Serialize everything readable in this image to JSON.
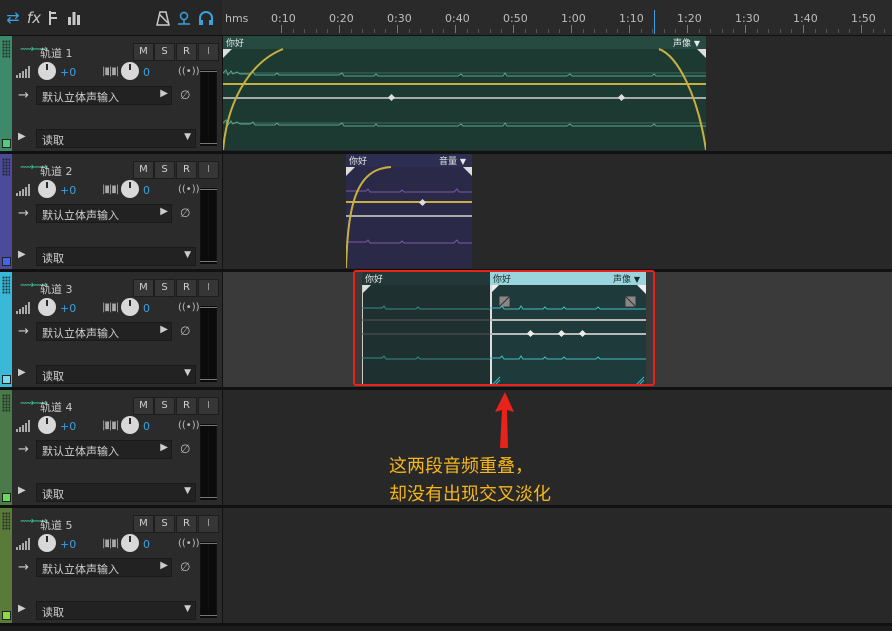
{
  "toolbar": {
    "icons": [
      "swap-icon",
      "fx-icon",
      "send-icon",
      "meter-icon",
      "metronome-icon",
      "record-monitor-icon",
      "headphones-icon"
    ],
    "fx_label": "fx"
  },
  "ruler": {
    "unit": "hms",
    "labels": [
      "0:10",
      "0:20",
      "0:30",
      "0:40",
      "0:50",
      "1:00",
      "1:10",
      "1:20",
      "1:30",
      "1:40",
      "1:50"
    ]
  },
  "tracks": [
    {
      "name": "轨道 1",
      "color": "#3d8a6a",
      "square": "#55cc77",
      "volume": "+0",
      "pan": "0",
      "input": "默认立体声输入",
      "automation": "读取",
      "btn_m": "M",
      "btn_s": "S",
      "btn_r": "R",
      "btn_i": "I"
    },
    {
      "name": "轨道 2",
      "color": "#4b4b9a",
      "square": "#4466ee",
      "volume": "+0",
      "pan": "0",
      "input": "默认立体声输入",
      "automation": "读取",
      "btn_m": "M",
      "btn_s": "S",
      "btn_r": "R",
      "btn_i": "I"
    },
    {
      "name": "轨道 3",
      "color": "#3ab8d8",
      "square": "#77ddee",
      "volume": "+0",
      "pan": "0",
      "input": "默认立体声输入",
      "automation": "读取",
      "btn_m": "M",
      "btn_s": "S",
      "btn_r": "R",
      "btn_i": "I"
    },
    {
      "name": "轨道 4",
      "color": "#4a7a4a",
      "square": "#66dd55",
      "volume": "+0",
      "pan": "0",
      "input": "默认立体声输入",
      "automation": "读取",
      "btn_m": "M",
      "btn_s": "S",
      "btn_r": "R",
      "btn_i": "I"
    },
    {
      "name": "轨道 5",
      "color": "#5a7a3a",
      "square": "#88dd44",
      "volume": "+0",
      "pan": "0",
      "input": "默认立体声输入",
      "automation": "读取",
      "btn_m": "M",
      "btn_s": "S",
      "btn_r": "R",
      "btn_i": "I"
    }
  ],
  "clips": {
    "t1": {
      "name": "你好",
      "param": "声像"
    },
    "t2": {
      "name": "你好",
      "param": "音量"
    },
    "t3a": {
      "name": "你好"
    },
    "t3b": {
      "name": "你好",
      "param": "声像"
    }
  },
  "annotation": {
    "line1": "这两段音频重叠，",
    "line2": "却没有出现交叉淡化",
    "color": "#f6b61a",
    "box_color": "#e8231c"
  },
  "icons": {
    "dropdown": "▼",
    "arrow_right": "→",
    "chevron": "❯",
    "phase": "∅",
    "play": "▶",
    "fx_knob": "((•))"
  }
}
